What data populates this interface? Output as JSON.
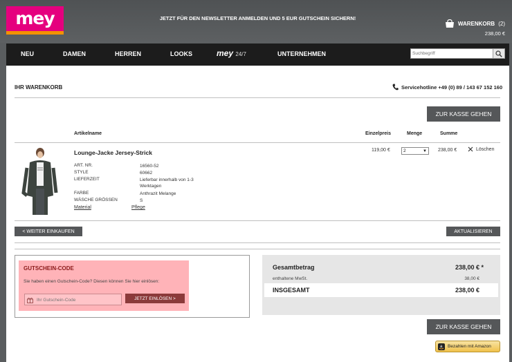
{
  "brand": {
    "logo": "mey"
  },
  "header": {
    "newsletter": "JETZT FÜR DEN NEWSLETTER ANMELDEN UND 5 EUR GUTSCHEIN SICHERN!",
    "cart_label": "WARENKORB",
    "cart_count": "(2)",
    "cart_sum": "238,00 €"
  },
  "nav": {
    "items": [
      "NEU",
      "DAMEN",
      "HERREN",
      "LOOKS",
      "UNTERNEHMEN"
    ],
    "brand_main": "mey",
    "brand_sub": "24/7",
    "search_placeholder": "Suchbegriff"
  },
  "page": {
    "title": "IHR WARENKORB",
    "hotline": "Servicehotline +49 (0) 89 / 143 67 152 160",
    "checkout_label": "ZUR KASSE GEHEN"
  },
  "table": {
    "headers": {
      "article": "Artikelname",
      "unit_price": "Einzelpreis",
      "quantity": "Menge",
      "total": "Summe"
    }
  },
  "product": {
    "name": "Lounge-Jacke Jersey-Strick",
    "attributes": [
      {
        "label": "ART. NR.",
        "value": "16560-52"
      },
      {
        "label": "STYLE",
        "value": "60662"
      },
      {
        "label": "LIEFERZEIT",
        "value": "Lieferbar innerhalb von 1-3 Werktagen"
      },
      {
        "label": "FARBE",
        "value": "Anthrazit Melange"
      },
      {
        "label": "WÄSCHE GRÖSSEN",
        "value": "S"
      }
    ],
    "material_link": "Material",
    "care_link": "Pflege",
    "unit_price": "119,00 €",
    "quantity": "2",
    "total": "238,00 €",
    "delete_label": "Löschen"
  },
  "actions": {
    "continue": "< WEITER EINKAUFEN",
    "update": "AKTUALISIEREN"
  },
  "voucher": {
    "title": "GUTSCHEIN-CODE",
    "description": "Sie haben einen Gutschein-Code? Diesen können Sie hier einlösen:",
    "placeholder": "Ihr Gutschein-Code",
    "button": "JETZT EINLÖSEN >"
  },
  "totals": {
    "gesamt_label": "Gesamtbetrag",
    "gesamt_value": "238,00 € *",
    "vat_label": "enthaltene MwSt.",
    "vat_value": "38,00 €",
    "total_label": "INSGESAMT",
    "total_value": "238,00 €"
  },
  "amazon_pay": "Bezahlen mit Amazon",
  "colors": {
    "brand_pink": "#e5007e",
    "brand_orange": "#f39200",
    "voucher_bg": "#ffb3b8",
    "voucher_button": "#8b3a3a"
  }
}
